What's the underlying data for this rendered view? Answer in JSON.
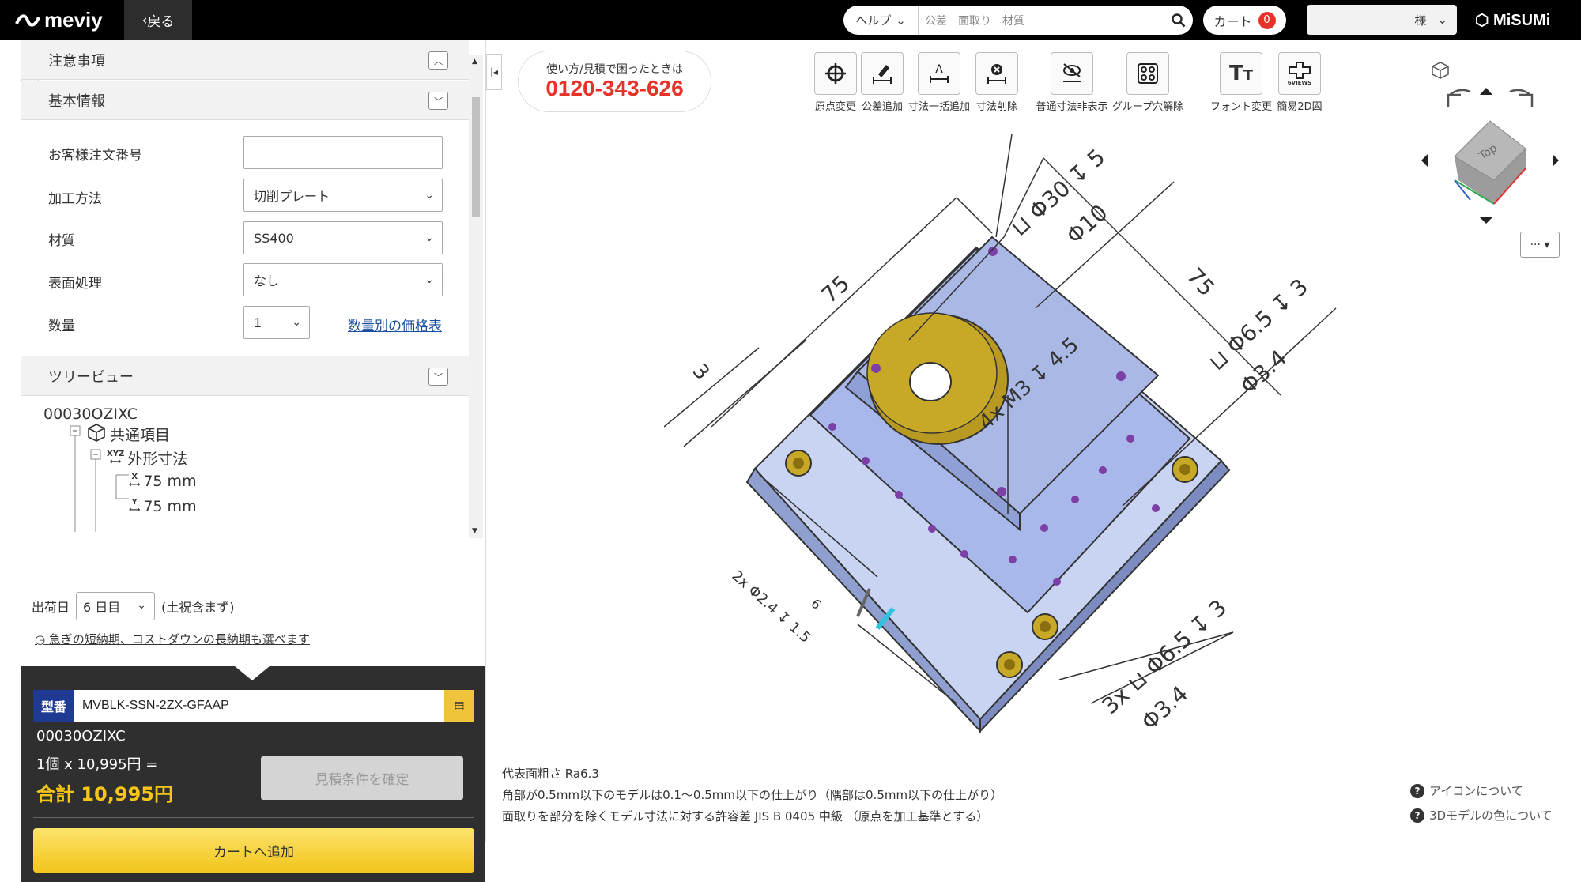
{
  "header": {
    "logo": "meviy",
    "back_label": "戻る",
    "help_label": "ヘルプ",
    "search_placeholder": "公差　面取り　材質",
    "cart_label": "カート",
    "cart_count": "0",
    "user_suffix": "様",
    "brand": "MiSUMi"
  },
  "sections": {
    "notes_title": "注意事項",
    "basic_title": "基本情報",
    "tree_title": "ツリービュー"
  },
  "form": {
    "order_no_label": "お客様注文番号",
    "order_no_value": "",
    "process_label": "加工方法",
    "process_value": "切削プレート",
    "material_label": "材質",
    "material_value": "SS400",
    "surface_label": "表面処理",
    "surface_value": "なし",
    "qty_label": "数量",
    "qty_value": "1",
    "qty_price_link": "数量別の価格表"
  },
  "tree": {
    "root": "00030OZIXC",
    "common": "共通項目",
    "outer": "外形寸法",
    "outer_icon_text": "XYZ",
    "x_axis": "X",
    "x_value": "75 mm",
    "y_axis": "Y",
    "y_value": "75 mm"
  },
  "shipping": {
    "label": "出荷日",
    "value": "6 日目",
    "note": "(土祝含まず)",
    "short_link": "急ぎの短納期、コストダウンの長納期も選べます"
  },
  "summary": {
    "part_tag": "型番",
    "part_number": "MVBLK-SSN-2ZX-GFAAP",
    "code": "00030OZIXC",
    "unit_line": "1個 x 10,995円 =",
    "total": "合計 10,995円",
    "confirm_label": "見積条件を確定",
    "add_cart_label": "カートへ追加"
  },
  "contact": {
    "caption": "使い方/見積で困ったときは",
    "phone": "0120-343-626"
  },
  "toolbar": [
    {
      "label": "原点変更",
      "icon": "origin-icon"
    },
    {
      "label": "公差追加",
      "icon": "tolerance-add-icon"
    },
    {
      "label": "寸法一括追加",
      "icon": "dimension-batch-icon"
    },
    {
      "label": "寸法削除",
      "icon": "dimension-delete-icon"
    },
    {
      "label": "普通寸法非表示",
      "icon": "hide-dimension-icon"
    },
    {
      "label": "グループ穴解除",
      "icon": "group-hole-icon"
    },
    {
      "label": "フォント変更",
      "icon": "font-icon"
    },
    {
      "label": "簡易2D図",
      "icon": "views-icon"
    }
  ],
  "toolbar_sub": {
    "views_caption": "6VIEWS"
  },
  "viewcube": {
    "face": "Top"
  },
  "annotations": {
    "dim75a": "75",
    "dim75b": "75",
    "dim3": "3",
    "hole1_a": "⊔ Φ30 ↧ 5",
    "hole1_b": "Φ10",
    "thread": "4x M3 ↧ 4.5",
    "hole2_a": "⊔ Φ6.5 ↧ 3",
    "hole2_b": "Φ3.4",
    "hole3_a": "3x ⊔ Φ6.5 ↧ 3",
    "hole3_b": "Φ3.4",
    "small_hole": "2x Φ2.4 ↧ 1.5",
    "dim6": "6"
  },
  "notes": {
    "line1": "代表面粗さ Ra6.3",
    "line2": "角部が0.5mm以下のモデルは0.1～0.5mm以下の仕上がり（隅部は0.5mm以下の仕上がり）",
    "line3": "面取りを部分を除くモデル寸法に対する許容差 JIS B 0405 中級 （原点を加工基準とする）"
  },
  "help_links": {
    "icons": "アイコンについて",
    "colors": "3Dモデルの色について"
  },
  "colors": {
    "topbar": "#000000",
    "accent_yellow": "#f2c51a",
    "phone_red": "#e5332a",
    "part_tag_blue": "#1f3a93",
    "model_blue": "#aab8e6",
    "model_gold": "#c8a827"
  }
}
